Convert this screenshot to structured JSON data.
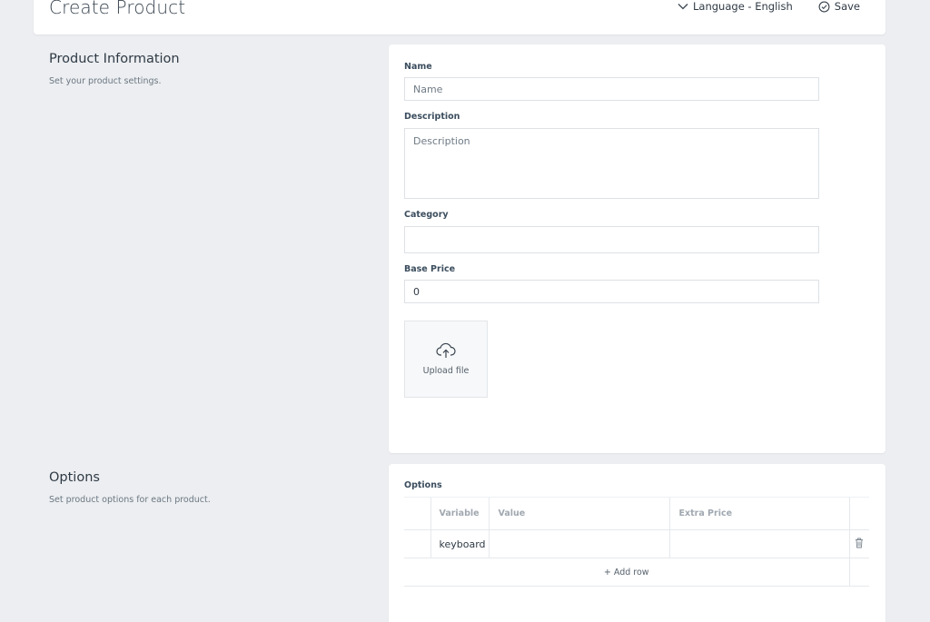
{
  "header": {
    "title": "Create Product",
    "language_label": "Language - English",
    "save_label": "Save"
  },
  "product_info": {
    "title": "Product Information",
    "subtitle": "Set your product settings.",
    "name_label": "Name",
    "name_placeholder": "Name",
    "description_label": "Description",
    "description_placeholder": "Description",
    "category_label": "Category",
    "base_price_label": "Base Price",
    "base_price_value": "0",
    "upload_label": "Upload file"
  },
  "options": {
    "title": "Options",
    "subtitle": "Set product options for each product.",
    "table_label": "Options",
    "columns": [
      "Variable",
      "Value",
      "Extra Price"
    ],
    "rows": [
      {
        "variable": "keyboard",
        "value": "",
        "extra_price": ""
      }
    ],
    "add_row_label": "+ Add row"
  },
  "icons": {
    "language": "chevron-down-icon",
    "save": "check-circle-icon",
    "upload": "cloud-upload-icon",
    "delete": "trash-icon"
  }
}
